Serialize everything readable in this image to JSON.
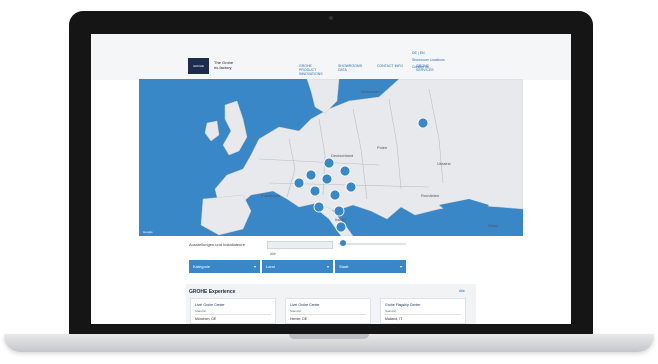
{
  "header": {
    "logo_text": "GROHE",
    "brand_line1": "The Grohe",
    "brand_line2": "ex-factory",
    "nav": [
      "GROHE PRODUCT INNOVATIONS",
      "SHOWROOMS DATA",
      "CONTACT INFO",
      "GROHE SERVICES"
    ],
    "utility": [
      "DE | EN",
      "Showroom Locations",
      "Contact us"
    ]
  },
  "map": {
    "credit": "Google",
    "country_labels": [
      "Frankreich",
      "Deutschland",
      "Italien",
      "Polen",
      "Ukraine",
      "Rumänien",
      "Schweden",
      "Türkei"
    ],
    "marker_count": 12
  },
  "filters": {
    "label": "Ausstellungen und Installateure",
    "select_value": "Alle",
    "dropdowns": [
      "Kategorie",
      "Land",
      "Stadt"
    ]
  },
  "experience": {
    "title": "GROHE Experience",
    "link": "Alle",
    "cards": [
      {
        "title": "Live! Grohe Center",
        "location": "Standort",
        "value": "München, DE"
      },
      {
        "title": "Live! Grohe Center",
        "location": "Standort",
        "value": "Hemer, DE"
      },
      {
        "title": "Grohe Flagship Center",
        "location": "Standort",
        "value": "Mailand, IT"
      }
    ]
  },
  "colors": {
    "map_water": "#3a87c8",
    "land": "#e7e9ec",
    "brand": "#1d2b4f"
  }
}
